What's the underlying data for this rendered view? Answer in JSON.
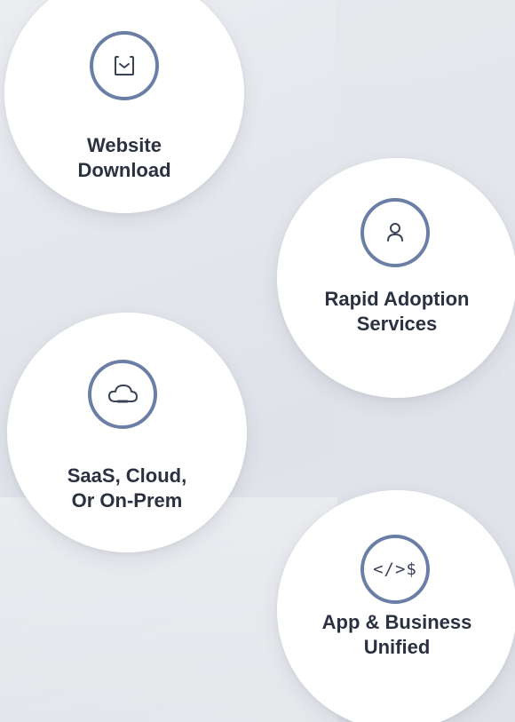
{
  "cards": [
    {
      "id": "website-download",
      "icon": "download-tray-icon",
      "line1": "Website",
      "line2": "Download"
    },
    {
      "id": "rapid-adoption",
      "icon": "user-icon",
      "line1": "Rapid Adoption",
      "line2": "Services"
    },
    {
      "id": "saas-cloud",
      "icon": "cloud-icon",
      "line1": "SaaS, Cloud,",
      "line2": "Or On-Prem"
    },
    {
      "id": "app-business",
      "icon": "code-dollar-icon",
      "icon_text": "</>$",
      "line1": "App & Business",
      "line2": "Unified"
    }
  ],
  "colors": {
    "ring": "#6b7fa6",
    "text": "#2b3140",
    "card": "#ffffff",
    "background": "#e4e6eb"
  }
}
